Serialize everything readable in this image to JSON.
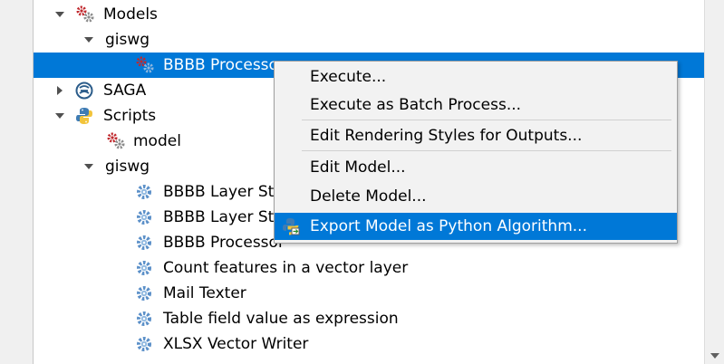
{
  "tree": {
    "models": {
      "label": "Models",
      "icon": "models-gears-icon"
    },
    "models_giswg": {
      "label": "giswg"
    },
    "selected_model": {
      "label": "BBBB Processo"
    },
    "saga": {
      "label": "SAGA",
      "icon": "saga-icon"
    },
    "scripts": {
      "label": "Scripts",
      "icon": "python-icon"
    },
    "scripts_model": {
      "label": "model"
    },
    "scripts_giswg": {
      "label": "giswg"
    },
    "scripts_items": [
      {
        "label": "BBBB Layer Sty"
      },
      {
        "label": "BBBB Layer Sty"
      },
      {
        "label": "BBBB Processor"
      },
      {
        "label": "Count features in a vector layer"
      },
      {
        "label": "Mail Texter"
      },
      {
        "label": "Table field value as expression"
      },
      {
        "label": "XLSX Vector Writer"
      }
    ]
  },
  "context_menu": {
    "items": [
      {
        "label": "Execute..."
      },
      {
        "label": "Execute as Batch Process..."
      },
      {
        "label": "Edit Rendering Styles for Outputs..."
      },
      {
        "label": "Edit Model..."
      },
      {
        "label": "Delete Model..."
      },
      {
        "label": "Export Model as Python Algorithm...",
        "icon": "python-export-icon"
      }
    ]
  },
  "colors": {
    "selection": "#0078d7",
    "gear_blue": "#5a8fc8",
    "gear_red": "#c0282d"
  }
}
